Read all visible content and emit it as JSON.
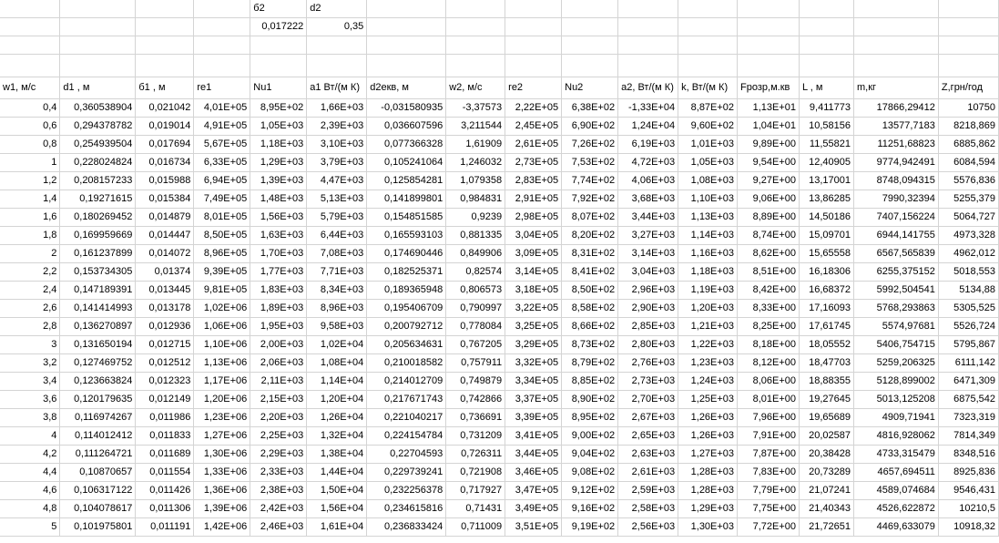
{
  "top": {
    "label_b2": "б2",
    "label_d2": "d2",
    "value_b2": "0,017222",
    "value_d2": "0,35"
  },
  "headers": [
    "w1, м/с",
    "d1 , м",
    "б1 , м",
    "re1",
    "Nu1",
    "a1 Вт/(м К)",
    "d2екв, м",
    "w2, м/с",
    "re2",
    "Nu2",
    "a2, Вт/(м К)",
    "k, Вт/(м К)",
    "Fрозр,м.кв",
    "L , м",
    "m,кг",
    "Z,грн/год"
  ],
  "rows": [
    [
      "0,4",
      "0,360538904",
      "0,021042",
      "4,01E+05",
      "8,95E+02",
      "1,66E+03",
      "-0,031580935",
      "-3,37573",
      "2,22E+05",
      "6,38E+02",
      "-1,33E+04",
      "8,87E+02",
      "1,13E+01",
      "9,411773",
      "17866,29412",
      "10750"
    ],
    [
      "0,6",
      "0,294378782",
      "0,019014",
      "4,91E+05",
      "1,05E+03",
      "2,39E+03",
      "0,036607596",
      "3,211544",
      "2,45E+05",
      "6,90E+02",
      "1,24E+04",
      "9,60E+02",
      "1,04E+01",
      "10,58156",
      "13577,7183",
      "8218,869"
    ],
    [
      "0,8",
      "0,254939504",
      "0,017694",
      "5,67E+05",
      "1,18E+03",
      "3,10E+03",
      "0,077366328",
      "1,61909",
      "2,61E+05",
      "7,26E+02",
      "6,19E+03",
      "1,01E+03",
      "9,89E+00",
      "11,55821",
      "11251,68823",
      "6885,862"
    ],
    [
      "1",
      "0,228024824",
      "0,016734",
      "6,33E+05",
      "1,29E+03",
      "3,79E+03",
      "0,105241064",
      "1,246032",
      "2,73E+05",
      "7,53E+02",
      "4,72E+03",
      "1,05E+03",
      "9,54E+00",
      "12,40905",
      "9774,942491",
      "6084,594"
    ],
    [
      "1,2",
      "0,208157233",
      "0,015988",
      "6,94E+05",
      "1,39E+03",
      "4,47E+03",
      "0,125854281",
      "1,079358",
      "2,83E+05",
      "7,74E+02",
      "4,06E+03",
      "1,08E+03",
      "9,27E+00",
      "13,17001",
      "8748,094315",
      "5576,836"
    ],
    [
      "1,4",
      "0,19271615",
      "0,015384",
      "7,49E+05",
      "1,48E+03",
      "5,13E+03",
      "0,141899801",
      "0,984831",
      "2,91E+05",
      "7,92E+02",
      "3,68E+03",
      "1,10E+03",
      "9,06E+00",
      "13,86285",
      "7990,32394",
      "5255,379"
    ],
    [
      "1,6",
      "0,180269452",
      "0,014879",
      "8,01E+05",
      "1,56E+03",
      "5,79E+03",
      "0,154851585",
      "0,9239",
      "2,98E+05",
      "8,07E+02",
      "3,44E+03",
      "1,13E+03",
      "8,89E+00",
      "14,50186",
      "7407,156224",
      "5064,727"
    ],
    [
      "1,8",
      "0,169959669",
      "0,014447",
      "8,50E+05",
      "1,63E+03",
      "6,44E+03",
      "0,165593103",
      "0,881335",
      "3,04E+05",
      "8,20E+02",
      "3,27E+03",
      "1,14E+03",
      "8,74E+00",
      "15,09701",
      "6944,141755",
      "4973,328"
    ],
    [
      "2",
      "0,161237899",
      "0,014072",
      "8,96E+05",
      "1,70E+03",
      "7,08E+03",
      "0,174690446",
      "0,849906",
      "3,09E+05",
      "8,31E+02",
      "3,14E+03",
      "1,16E+03",
      "8,62E+00",
      "15,65558",
      "6567,565839",
      "4962,012"
    ],
    [
      "2,2",
      "0,153734305",
      "0,01374",
      "9,39E+05",
      "1,77E+03",
      "7,71E+03",
      "0,182525371",
      "0,82574",
      "3,14E+05",
      "8,41E+02",
      "3,04E+03",
      "1,18E+03",
      "8,51E+00",
      "16,18306",
      "6255,375152",
      "5018,553"
    ],
    [
      "2,4",
      "0,147189391",
      "0,013445",
      "9,81E+05",
      "1,83E+03",
      "8,34E+03",
      "0,189365948",
      "0,806573",
      "3,18E+05",
      "8,50E+02",
      "2,96E+03",
      "1,19E+03",
      "8,42E+00",
      "16,68372",
      "5992,504541",
      "5134,88"
    ],
    [
      "2,6",
      "0,141414993",
      "0,013178",
      "1,02E+06",
      "1,89E+03",
      "8,96E+03",
      "0,195406709",
      "0,790997",
      "3,22E+05",
      "8,58E+02",
      "2,90E+03",
      "1,20E+03",
      "8,33E+00",
      "17,16093",
      "5768,293863",
      "5305,525"
    ],
    [
      "2,8",
      "0,136270897",
      "0,012936",
      "1,06E+06",
      "1,95E+03",
      "9,58E+03",
      "0,200792712",
      "0,778084",
      "3,25E+05",
      "8,66E+02",
      "2,85E+03",
      "1,21E+03",
      "8,25E+00",
      "17,61745",
      "5574,97681",
      "5526,724"
    ],
    [
      "3",
      "0,131650194",
      "0,012715",
      "1,10E+06",
      "2,00E+03",
      "1,02E+04",
      "0,205634631",
      "0,767205",
      "3,29E+05",
      "8,73E+02",
      "2,80E+03",
      "1,22E+03",
      "8,18E+00",
      "18,05552",
      "5406,754715",
      "5795,867"
    ],
    [
      "3,2",
      "0,127469752",
      "0,012512",
      "1,13E+06",
      "2,06E+03",
      "1,08E+04",
      "0,210018582",
      "0,757911",
      "3,32E+05",
      "8,79E+02",
      "2,76E+03",
      "1,23E+03",
      "8,12E+00",
      "18,47703",
      "5259,206325",
      "6111,142"
    ],
    [
      "3,4",
      "0,123663824",
      "0,012323",
      "1,17E+06",
      "2,11E+03",
      "1,14E+04",
      "0,214012709",
      "0,749879",
      "3,34E+05",
      "8,85E+02",
      "2,73E+03",
      "1,24E+03",
      "8,06E+00",
      "18,88355",
      "5128,899002",
      "6471,309"
    ],
    [
      "3,6",
      "0,120179635",
      "0,012149",
      "1,20E+06",
      "2,15E+03",
      "1,20E+04",
      "0,217671743",
      "0,742866",
      "3,37E+05",
      "8,90E+02",
      "2,70E+03",
      "1,25E+03",
      "8,01E+00",
      "19,27645",
      "5013,125208",
      "6875,542"
    ],
    [
      "3,8",
      "0,116974267",
      "0,011986",
      "1,23E+06",
      "2,20E+03",
      "1,26E+04",
      "0,221040217",
      "0,736691",
      "3,39E+05",
      "8,95E+02",
      "2,67E+03",
      "1,26E+03",
      "7,96E+00",
      "19,65689",
      "4909,71941",
      "7323,319"
    ],
    [
      "4",
      "0,114012412",
      "0,011833",
      "1,27E+06",
      "2,25E+03",
      "1,32E+04",
      "0,224154784",
      "0,731209",
      "3,41E+05",
      "9,00E+02",
      "2,65E+03",
      "1,26E+03",
      "7,91E+00",
      "20,02587",
      "4816,928062",
      "7814,349"
    ],
    [
      "4,2",
      "0,111264721",
      "0,011689",
      "1,30E+06",
      "2,29E+03",
      "1,38E+04",
      "0,22704593",
      "0,726311",
      "3,44E+05",
      "9,04E+02",
      "2,63E+03",
      "1,27E+03",
      "7,87E+00",
      "20,38428",
      "4733,315479",
      "8348,516"
    ],
    [
      "4,4",
      "0,10870657",
      "0,011554",
      "1,33E+06",
      "2,33E+03",
      "1,44E+04",
      "0,229739241",
      "0,721908",
      "3,46E+05",
      "9,08E+02",
      "2,61E+03",
      "1,28E+03",
      "7,83E+00",
      "20,73289",
      "4657,694511",
      "8925,836"
    ],
    [
      "4,6",
      "0,106317122",
      "0,011426",
      "1,36E+06",
      "2,38E+03",
      "1,50E+04",
      "0,232256378",
      "0,717927",
      "3,47E+05",
      "9,12E+02",
      "2,59E+03",
      "1,28E+03",
      "7,79E+00",
      "21,07241",
      "4589,074684",
      "9546,431"
    ],
    [
      "4,8",
      "0,104078617",
      "0,011306",
      "1,39E+06",
      "2,42E+03",
      "1,56E+04",
      "0,234615816",
      "0,71431",
      "3,49E+05",
      "9,16E+02",
      "2,58E+03",
      "1,29E+03",
      "7,75E+00",
      "21,40343",
      "4526,622872",
      "10210,5"
    ],
    [
      "5",
      "0,101975801",
      "0,011191",
      "1,42E+06",
      "2,46E+03",
      "1,61E+04",
      "0,236833424",
      "0,711009",
      "3,51E+05",
      "9,19E+02",
      "2,56E+03",
      "1,30E+03",
      "7,72E+00",
      "21,72651",
      "4469,633079",
      "10918,32"
    ]
  ]
}
